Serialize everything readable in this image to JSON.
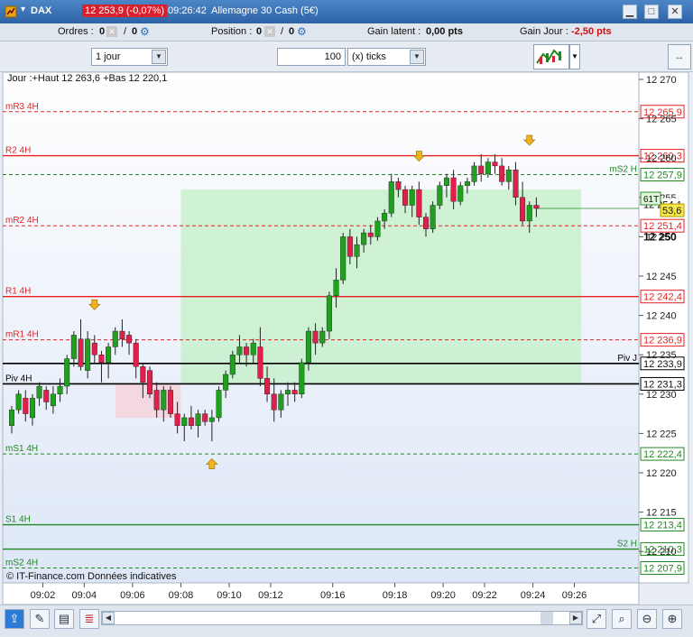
{
  "titlebar": {
    "ticker": "DAX",
    "price_change": "12 253,9 (-0,07%)",
    "time": "09:26:42",
    "instrument": "Allemagne 30 Cash (5€)"
  },
  "statusrow": {
    "orders_label": "Ordres :",
    "orders_value1": "0",
    "orders_value2": "0",
    "position_label": "Position :",
    "position_value1": "0",
    "position_value2": "0",
    "gain_latent_label": "Gain latent :",
    "gain_latent_value": "0,00 pts",
    "gain_jour_label": "Gain Jour :",
    "gain_jour_value": "-2,50 pts"
  },
  "toolbar": {
    "period": "1 jour",
    "tick_count": "100",
    "tick_unit": "(x) ticks"
  },
  "colors": {
    "up": "#21a020",
    "down": "#e0204a",
    "resistance": "#e82020",
    "support": "#1f8a1f",
    "pivot": "#000000"
  },
  "chart_data": {
    "type": "candlestick",
    "header": "Jour :+Haut 12 263,6 +Bas 12 220,1",
    "watermark": "© IT-Finance.com Données indicatives",
    "y_ticks": [
      "12 270",
      "12 265",
      "12 260",
      "12 255",
      "12 250",
      "12 245",
      "12 240",
      "12 235",
      "12 230",
      "12 225",
      "12 220",
      "12 215",
      "12 210"
    ],
    "y_tick_values": [
      12270,
      12265,
      12260,
      12255,
      12250,
      12245,
      12240,
      12235,
      12230,
      12225,
      12220,
      12215,
      12210
    ],
    "x_ticks": [
      {
        "label": "09:02",
        "index": 4.5
      },
      {
        "label": "09:04",
        "index": 10.5
      },
      {
        "label": "09:06",
        "index": 17.5
      },
      {
        "label": "09:08",
        "index": 24.5
      },
      {
        "label": "09:10",
        "index": 31.5
      },
      {
        "label": "09:12",
        "index": 37.5
      },
      {
        "label": "09:16",
        "index": 46.5
      },
      {
        "label": "09:18",
        "index": 55.5
      },
      {
        "label": "09:20",
        "index": 62.5
      },
      {
        "label": "09:22",
        "index": 68.5
      },
      {
        "label": "09:24",
        "index": 75.5
      },
      {
        "label": "09:26",
        "index": 81.5
      }
    ],
    "levels": [
      {
        "name": "mR3 4H",
        "value": 12265.9,
        "label": "12 265,9",
        "kind": "resistance",
        "style": "dashed"
      },
      {
        "name": "R2 4H",
        "value": 12260.3,
        "label": "12 260,3",
        "kind": "resistance",
        "style": "solid"
      },
      {
        "name": "mS2 H",
        "value": 12257.9,
        "label": "12 257,9",
        "kind": "support",
        "style": "dashed",
        "label_side": "right"
      },
      {
        "name": "mR2 4H",
        "value": 12251.4,
        "label": "12 251,4",
        "kind": "resistance",
        "style": "dashed"
      },
      {
        "name": "R1 4H",
        "value": 12242.4,
        "label": "12 242,4",
        "kind": "resistance",
        "style": "solid"
      },
      {
        "name": "mR1 4H",
        "value": 12236.9,
        "label": "12 236,9",
        "kind": "resistance",
        "style": "dashed"
      },
      {
        "name": "Piv J",
        "value": 12233.9,
        "label": "12 233,9",
        "kind": "pivot",
        "style": "solid",
        "label_side": "right"
      },
      {
        "name": "Piv 4H",
        "value": 12231.3,
        "label": "12 231,3",
        "kind": "pivot",
        "style": "solid"
      },
      {
        "name": "mS1 4H",
        "value": 12222.4,
        "label": "12 222,4",
        "kind": "support",
        "style": "dashed"
      },
      {
        "name": "S1 4H",
        "value": 12213.4,
        "label": "12 213,4",
        "kind": "support",
        "style": "solid"
      },
      {
        "name": "S2 H",
        "value": 12210.3,
        "label": "12 210,3",
        "kind": "support",
        "style": "solid",
        "label_side": "right"
      },
      {
        "name": "mS2 4H",
        "value": 12207.9,
        "label": "12 207,9",
        "kind": "support",
        "style": "dashed"
      }
    ],
    "price_boxes": [
      {
        "label": "12 254,1",
        "value": 12254.1,
        "style": "plain"
      },
      {
        "label": "61T",
        "value": 12254.4,
        "style": "green",
        "side": "left"
      },
      {
        "label": "53,6",
        "value": 12253.6,
        "style": "yellow"
      },
      {
        "label": "12 250",
        "value": 12250,
        "style": "bold"
      }
    ],
    "zones": [
      {
        "from_index": 24.5,
        "to_index": 82.5,
        "low": 12231.3,
        "high": 12256.0,
        "color": "#c8f0cc"
      },
      {
        "from_index": 15,
        "to_index": 24.5,
        "low": 12227,
        "high": 12231.3,
        "color": "#f6d3dc"
      }
    ],
    "arrows": [
      {
        "index": 12,
        "price": 12241.3,
        "dir": "down"
      },
      {
        "index": 29,
        "price": 12221.2,
        "dir": "up"
      },
      {
        "index": 59,
        "price": 12260.2,
        "dir": "down"
      },
      {
        "index": 75,
        "price": 12262.2,
        "dir": "down"
      }
    ],
    "candles": [
      [
        12226.0,
        12228.5,
        12225.0,
        12228.0
      ],
      [
        12228.0,
        12230.5,
        12227.5,
        12230.0
      ],
      [
        12229.5,
        12230.5,
        12226.5,
        12227.5
      ],
      [
        12227.0,
        12230.0,
        12226.0,
        12229.5
      ],
      [
        12229.5,
        12231.5,
        12228.5,
        12231.0
      ],
      [
        12230.5,
        12231.0,
        12228.0,
        12229.0
      ],
      [
        12228.5,
        12231.0,
        12227.5,
        12230.0
      ],
      [
        12230.0,
        12232.0,
        12229.0,
        12231.0
      ],
      [
        12231.0,
        12235.0,
        12230.0,
        12234.5
      ],
      [
        12234.5,
        12238.0,
        12233.5,
        12237.5
      ],
      [
        12237.0,
        12239.5,
        12233.0,
        12233.5
      ],
      [
        12233.0,
        12238.0,
        12232.0,
        12237.0
      ],
      [
        12236.5,
        12237.5,
        12234.0,
        12235.0
      ],
      [
        12235.0,
        12235.5,
        12231.5,
        12234.0
      ],
      [
        12234.0,
        12236.5,
        12232.0,
        12236.0
      ],
      [
        12236.0,
        12238.5,
        12235.0,
        12238.0
      ],
      [
        12238.0,
        12239.5,
        12236.0,
        12237.0
      ],
      [
        12237.5,
        12238.0,
        12235.0,
        12236.5
      ],
      [
        12236.5,
        12237.0,
        12232.0,
        12233.5
      ],
      [
        12233.5,
        12234.0,
        12229.5,
        12231.5
      ],
      [
        12233.0,
        12233.5,
        12229.5,
        12230.0
      ],
      [
        12230.5,
        12231.5,
        12227.0,
        12228.0
      ],
      [
        12228.0,
        12231.0,
        12226.5,
        12230.5
      ],
      [
        12230.5,
        12231.0,
        12227.0,
        12227.5
      ],
      [
        12227.5,
        12229.0,
        12225.0,
        12226.0
      ],
      [
        12226.0,
        12227.5,
        12224.0,
        12227.0
      ],
      [
        12227.0,
        12228.5,
        12225.5,
        12226.0
      ],
      [
        12226.0,
        12228.0,
        12224.5,
        12227.5
      ],
      [
        12227.5,
        12228.0,
        12226.0,
        12226.5
      ],
      [
        12226.5,
        12228.0,
        12224.0,
        12227.0
      ],
      [
        12227.0,
        12231.0,
        12226.5,
        12230.5
      ],
      [
        12230.5,
        12233.0,
        12229.5,
        12232.5
      ],
      [
        12232.5,
        12235.5,
        12232.0,
        12235.0
      ],
      [
        12235.0,
        12237.5,
        12234.0,
        12236.0
      ],
      [
        12236.0,
        12236.5,
        12233.5,
        12235.0
      ],
      [
        12235.0,
        12237.0,
        12234.0,
        12236.5
      ],
      [
        12236.0,
        12238.5,
        12231.0,
        12232.0
      ],
      [
        12232.0,
        12233.5,
        12229.0,
        12230.0
      ],
      [
        12230.0,
        12232.0,
        12226.5,
        12228.0
      ],
      [
        12228.0,
        12230.5,
        12227.0,
        12230.0
      ],
      [
        12230.0,
        12231.5,
        12228.5,
        12230.5
      ],
      [
        12230.5,
        12231.5,
        12229.0,
        12230.0
      ],
      [
        12230.0,
        12234.5,
        12229.5,
        12234.0
      ],
      [
        12234.0,
        12238.5,
        12233.0,
        12238.0
      ],
      [
        12238.0,
        12239.0,
        12235.0,
        12236.5
      ],
      [
        12236.5,
        12238.5,
        12236.0,
        12238.0
      ],
      [
        12238.0,
        12243.0,
        12237.0,
        12242.5
      ],
      [
        12242.5,
        12246.0,
        12241.0,
        12244.5
      ],
      [
        12244.5,
        12250.5,
        12244.0,
        12250.0
      ],
      [
        12250.0,
        12251.0,
        12246.5,
        12247.5
      ],
      [
        12247.5,
        12250.0,
        12246.0,
        12249.0
      ],
      [
        12249.0,
        12251.0,
        12248.0,
        12250.5
      ],
      [
        12250.5,
        12251.5,
        12249.0,
        12250.0
      ],
      [
        12250.0,
        12252.5,
        12249.5,
        12252.0
      ],
      [
        12252.0,
        12253.5,
        12251.0,
        12253.0
      ],
      [
        12253.0,
        12258.0,
        12252.5,
        12257.0
      ],
      [
        12257.0,
        12257.5,
        12255.0,
        12256.0
      ],
      [
        12256.0,
        12256.5,
        12253.0,
        12254.0
      ],
      [
        12254.0,
        12256.5,
        12252.5,
        12256.0
      ],
      [
        12256.0,
        12257.0,
        12251.5,
        12252.5
      ],
      [
        12252.5,
        12253.0,
        12250.0,
        12251.0
      ],
      [
        12251.0,
        12254.5,
        12250.5,
        12254.0
      ],
      [
        12254.0,
        12257.0,
        12253.5,
        12256.5
      ],
      [
        12256.5,
        12258.0,
        12255.0,
        12257.5
      ],
      [
        12257.5,
        12258.5,
        12253.5,
        12254.5
      ],
      [
        12254.5,
        12257.0,
        12254.0,
        12256.5
      ],
      [
        12256.5,
        12257.5,
        12255.5,
        12257.0
      ],
      [
        12257.0,
        12259.5,
        12256.5,
        12259.0
      ],
      [
        12259.0,
        12260.5,
        12257.0,
        12258.0
      ],
      [
        12258.0,
        12260.0,
        12257.5,
        12259.5
      ],
      [
        12259.5,
        12260.5,
        12258.0,
        12259.0
      ],
      [
        12259.0,
        12260.0,
        12256.5,
        12257.0
      ],
      [
        12257.0,
        12259.0,
        12256.0,
        12258.5
      ],
      [
        12258.5,
        12259.5,
        12254.0,
        12255.0
      ],
      [
        12255.0,
        12257.0,
        12251.5,
        12252.0
      ],
      [
        12252.0,
        12254.5,
        12250.5,
        12254.0
      ],
      [
        12254.0,
        12255.0,
        12252.5,
        12253.6
      ]
    ]
  }
}
